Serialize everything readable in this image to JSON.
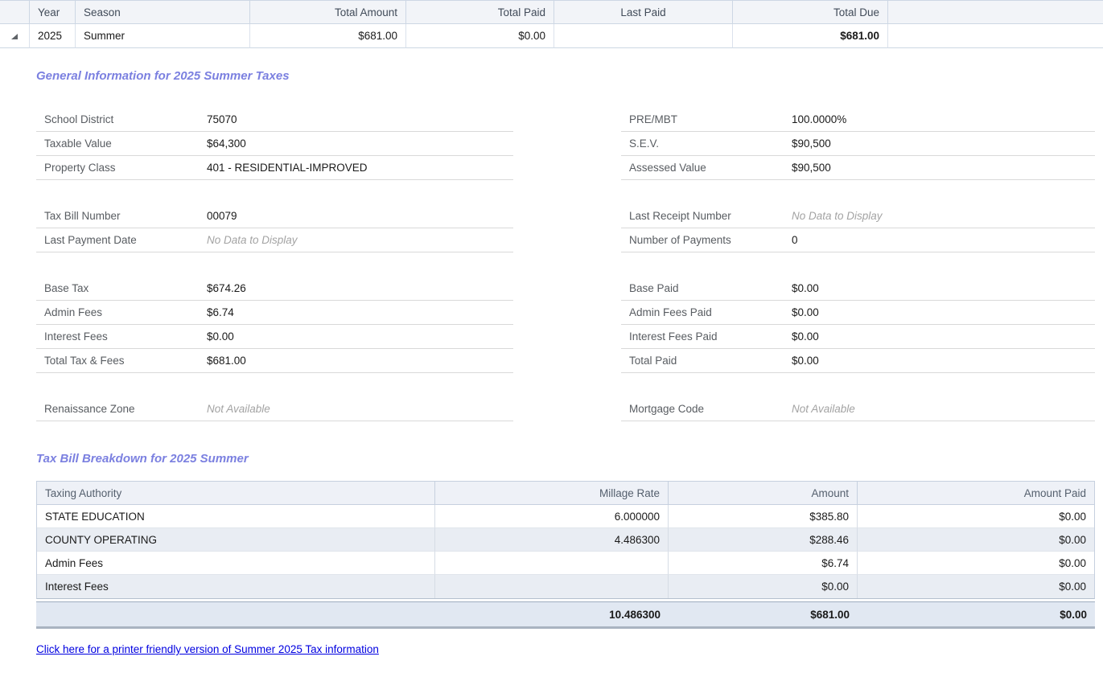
{
  "summary": {
    "headers": {
      "year": "Year",
      "season": "Season",
      "total_amount": "Total Amount",
      "total_paid": "Total Paid",
      "last_paid": "Last Paid",
      "total_due": "Total Due"
    },
    "row": {
      "year": "2025",
      "season": "Summer",
      "total_amount": "$681.00",
      "total_paid": "$0.00",
      "last_paid": "",
      "total_due": "$681.00"
    },
    "expander_icon": "expanded-triangle"
  },
  "info": {
    "heading": "General Information for 2025 Summer Taxes",
    "left": [
      {
        "rows": [
          {
            "label": "School District",
            "value": "75070"
          },
          {
            "label": "Taxable Value",
            "value": "$64,300"
          },
          {
            "label": "Property Class",
            "value": "401 - RESIDENTIAL-IMPROVED"
          }
        ]
      },
      {
        "rows": [
          {
            "label": "Tax Bill Number",
            "value": "00079"
          },
          {
            "label": "Last Payment Date",
            "value": "No Data to Display",
            "muted": true
          }
        ]
      },
      {
        "rows": [
          {
            "label": "Base Tax",
            "value": "$674.26"
          },
          {
            "label": "Admin Fees",
            "value": "$6.74"
          },
          {
            "label": "Interest Fees",
            "value": "$0.00"
          },
          {
            "label": "Total Tax & Fees",
            "value": "$681.00"
          }
        ]
      },
      {
        "rows": [
          {
            "label": "Renaissance Zone",
            "value": "Not Available",
            "muted": true
          }
        ]
      }
    ],
    "right": [
      {
        "rows": [
          {
            "label": "PRE/MBT",
            "value": "100.0000%"
          },
          {
            "label": "S.E.V.",
            "value": "$90,500"
          },
          {
            "label": "Assessed Value",
            "value": "$90,500"
          }
        ]
      },
      {
        "rows": [
          {
            "label": "Last Receipt Number",
            "value": "No Data to Display",
            "muted": true
          },
          {
            "label": "Number of Payments",
            "value": "0"
          }
        ]
      },
      {
        "rows": [
          {
            "label": "Base Paid",
            "value": "$0.00"
          },
          {
            "label": "Admin Fees Paid",
            "value": "$0.00"
          },
          {
            "label": "Interest Fees Paid",
            "value": "$0.00"
          },
          {
            "label": "Total Paid",
            "value": "$0.00"
          }
        ]
      },
      {
        "rows": [
          {
            "label": "Mortgage Code",
            "value": "Not Available",
            "muted": true
          }
        ]
      }
    ]
  },
  "breakdown": {
    "heading": "Tax Bill Breakdown for 2025 Summer",
    "headers": {
      "authority": "Taxing Authority",
      "millage": "Millage Rate",
      "amount": "Amount",
      "paid": "Amount Paid"
    },
    "rows": [
      {
        "authority": "STATE EDUCATION",
        "millage": "6.000000",
        "amount": "$385.80",
        "paid": "$0.00"
      },
      {
        "authority": "COUNTY OPERATING",
        "millage": "4.486300",
        "amount": "$288.46",
        "paid": "$0.00"
      },
      {
        "authority": "Admin Fees",
        "millage": "",
        "amount": "$6.74",
        "paid": "$0.00"
      },
      {
        "authority": "Interest Fees",
        "millage": "",
        "amount": "$0.00",
        "paid": "$0.00"
      }
    ],
    "total": {
      "authority": "",
      "millage": "10.486300",
      "amount": "$681.00",
      "paid": "$0.00"
    }
  },
  "footer": {
    "link_label": "Click here for a printer friendly version of Summer 2025 Tax information"
  },
  "colors": {
    "heading_accent": "#7b80e0",
    "link": "#0000e0",
    "grid_header_bg": "#f2f4f8",
    "grid_border": "#cdd7e4",
    "row_stripe": "#e9edf3",
    "total_row_bg": "#e1e8f2",
    "muted_text": "#a3a3a3"
  }
}
